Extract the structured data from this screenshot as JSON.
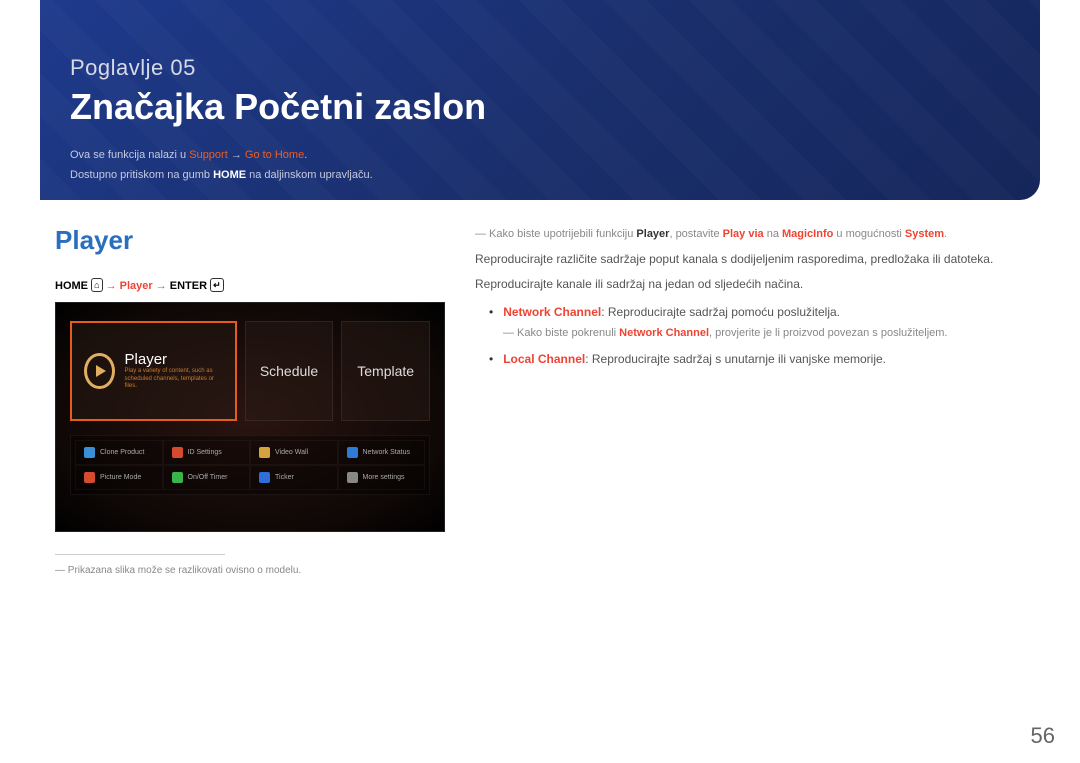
{
  "header": {
    "chapter_prefix": "Poglavlje",
    "chapter_num": "05",
    "title": "Značajka Početni zaslon",
    "intro_line1_a": "Ova se funkcija nalazi u ",
    "intro_support": "Support",
    "intro_arrow": " → ",
    "intro_goto": "Go to Home",
    "intro_line2_a": "Dostupno pritiskom na gumb ",
    "intro_home": "HOME",
    "intro_line2_b": " na daljinskom upravljaču."
  },
  "section": {
    "heading": "Player",
    "nav_home": "HOME",
    "nav_home_sym": "⌂",
    "nav_arrow": " → ",
    "nav_player": "Player",
    "nav_arrow2": " →",
    "nav_enter": "ENTER",
    "nav_enter_sym": "↵",
    "footnote": "― Prikazana slika može se razlikovati ovisno o modelu."
  },
  "screen": {
    "tiles": {
      "player": {
        "title": "Player",
        "sub": "Play a variety of content, such as scheduled channels, templates or files."
      },
      "schedule": "Schedule",
      "template": "Template"
    },
    "grid": [
      {
        "label": "Clone Product",
        "color": "#3a8ed6"
      },
      {
        "label": "ID Settings",
        "color": "#d64a2e"
      },
      {
        "label": "Video Wall",
        "color": "#d6a43a"
      },
      {
        "label": "Network Status",
        "color": "#2e7ad6"
      },
      {
        "label": "Picture Mode",
        "color": "#d64a2e"
      },
      {
        "label": "On/Off Timer",
        "color": "#3ab54a"
      },
      {
        "label": "Ticker",
        "color": "#2e6ed6"
      },
      {
        "label": "More settings",
        "color": "#888"
      }
    ]
  },
  "right": {
    "lead1a": "― Kako biste upotrijebili funkciju ",
    "lead1_player": "Player",
    "lead1b": ", postavite ",
    "lead1_playvia": "Play via",
    "lead1c": " na ",
    "lead1_magic": "MagicInfo",
    "lead1d": " u mogućnosti ",
    "lead1_system": "System",
    "para1": "Reproducirajte različite sadržaje poput kanala s dodijeljenim rasporedima, predložaka ili datoteka.",
    "para2": "Reproducirajte kanale ili sadržaj na jedan od sljedećih načina.",
    "b1_label": "Network Channel",
    "b1_text": ": Reproducirajte sadržaj pomoću poslužitelja.",
    "b1_sub_a": "― Kako biste pokrenuli ",
    "b1_sub_nc": "Network Channel",
    "b1_sub_b": ", provjerite je li proizvod povezan s poslužiteljem.",
    "b2_label": "Local Channel",
    "b2_text": ": Reproducirajte sadržaj s unutarnje ili vanjske memorije."
  },
  "page": "56"
}
